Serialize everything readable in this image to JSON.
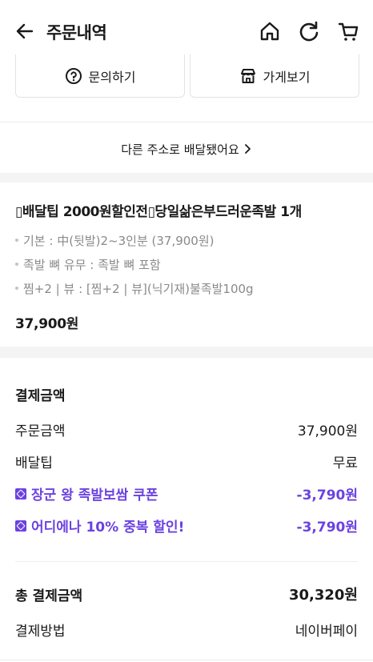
{
  "header": {
    "title": "주문내역"
  },
  "top_buttons": {
    "inquiry_label": "문의하기",
    "store_label": "가게보기"
  },
  "address_notice": {
    "text": "다른 주소로 배달됐어요",
    "chevron": ">"
  },
  "order_item": {
    "title": "▯배달팁 2000원할인전▯당일삶은부드러운족발 1개",
    "options": [
      "기본 : 中(뒷발)2~3인분 (37,900원)",
      "족발 뼈 유무 : 족발 뼈 포함",
      "찜+2 | 뷰 : [찜+2 | 뷰](닉기재)불족발100g"
    ],
    "price": "37,900원"
  },
  "payment": {
    "section_title": "결제금액",
    "order_amount_label": "주문금액",
    "order_amount_value": "37,900원",
    "delivery_tip_label": "배달팁",
    "delivery_tip_value": "무료",
    "discounts": [
      {
        "label": "장군 왕 족발보쌈 쿠폰",
        "value": "-3,790원"
      },
      {
        "label": "어디에나 10% 중복 할인!",
        "value": "-3,790원"
      }
    ],
    "total_label": "총 결제금액",
    "total_value": "30,320원",
    "method_label": "결제방법",
    "method_value": "네이버페이"
  },
  "colors": {
    "accent": "#6b42e0",
    "muted_text": "#8a8a8a",
    "band": "#f4f4f5"
  },
  "icons": [
    "back-arrow-icon",
    "home-icon",
    "refresh-icon",
    "cart-icon",
    "question-icon",
    "store-icon",
    "chevron-right-icon",
    "coupon-icon"
  ]
}
